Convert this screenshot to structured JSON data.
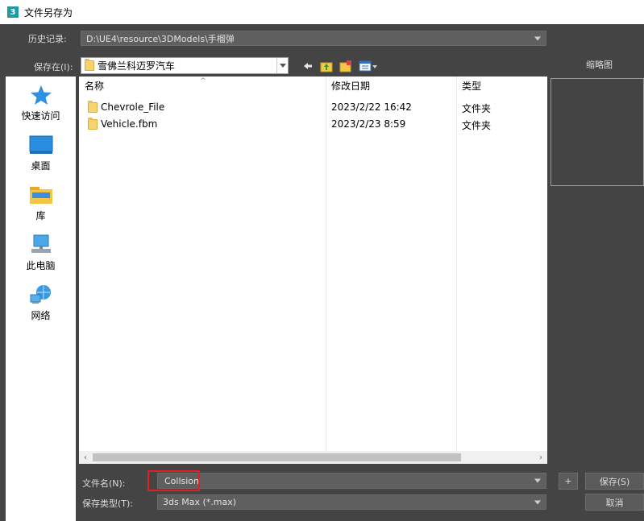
{
  "window": {
    "title": "文件另存为",
    "app_icon_text": "3"
  },
  "history": {
    "label": "历史记录:",
    "value": "D:\\UE4\\resource\\3DModels\\手榴弹"
  },
  "save_in": {
    "label": "保存在(I):",
    "value": "雪佛兰科迈罗汽车"
  },
  "thumbnail_label": "缩略图",
  "places": [
    {
      "label": "快速访问",
      "icon": "star-pin-icon"
    },
    {
      "label": "桌面",
      "icon": "desktop-icon"
    },
    {
      "label": "库",
      "icon": "library-icon"
    },
    {
      "label": "此电脑",
      "icon": "computer-icon"
    },
    {
      "label": "网络",
      "icon": "network-icon"
    }
  ],
  "file_list": {
    "columns": {
      "name": "名称",
      "date": "修改日期",
      "type": "类型"
    },
    "rows": [
      {
        "name": "Chevrole_File",
        "date": "2023/2/22 16:42",
        "type": "文件夹"
      },
      {
        "name": "Vehicle.fbm",
        "date": "2023/2/23 8:59",
        "type": "文件夹"
      }
    ]
  },
  "file_name": {
    "label": "文件名(N):",
    "value": "Collsion"
  },
  "save_type": {
    "label": "保存类型(T):",
    "value": "3ds Max (*.max)"
  },
  "buttons": {
    "plus": "+",
    "save": "保存(S)",
    "cancel": "取消"
  },
  "colors": {
    "highlight_box": "#e02020",
    "folder": "#f6d36b",
    "background": "#444444"
  }
}
